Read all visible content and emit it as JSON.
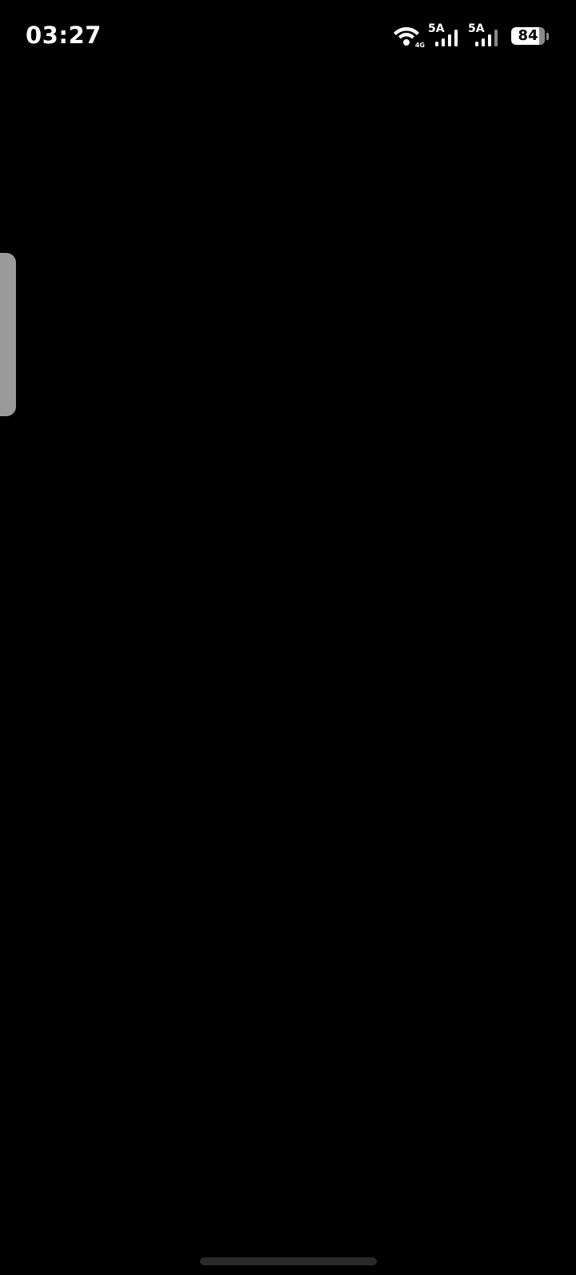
{
  "status_bar": {
    "time": "03:27",
    "wifi": {
      "icon": "wifi-icon",
      "tag": "4G"
    },
    "sim1": {
      "network": "5A",
      "icon": "signal-bars-icon"
    },
    "sim2": {
      "network": "5A",
      "icon": "signal-bars-icon"
    },
    "battery": {
      "level": "84",
      "icon": "battery-icon",
      "level_fraction": 0.84
    }
  },
  "overlays": {
    "edge_handle": "side-panel-handle",
    "home_indicator": "gesture-bar"
  },
  "colors": {
    "background": "#000000",
    "foreground": "#ffffff",
    "handle": "#9a9a9a",
    "home_bar": "#2a2a2a"
  }
}
